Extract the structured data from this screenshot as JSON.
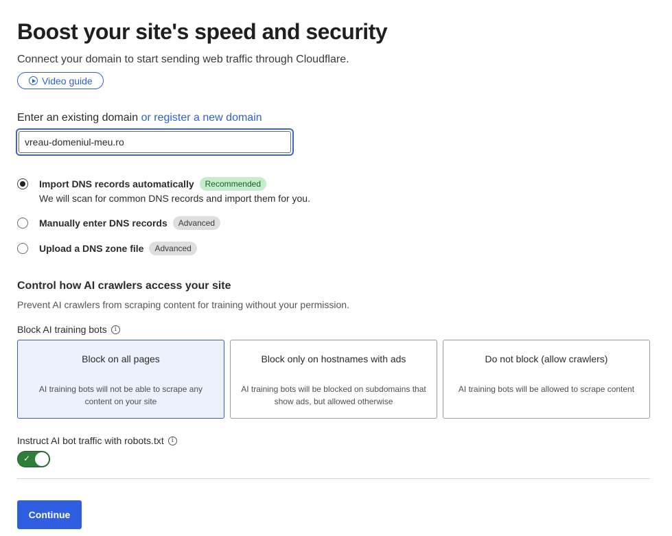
{
  "header": {
    "title": "Boost your site's speed and security",
    "subtitle": "Connect your domain to start sending web traffic through Cloudflare.",
    "video_guide_label": "Video guide"
  },
  "domain": {
    "label": "Enter an existing domain",
    "register_link": "or register a new domain",
    "value": "vreau-domeniul-meu.ro"
  },
  "dns_options": [
    {
      "label": "Import DNS records automatically",
      "badge": "Recommended",
      "selected": true,
      "description": "We will scan for common DNS records and import them for you."
    },
    {
      "label": "Manually enter DNS records",
      "badge": "Advanced",
      "selected": false
    },
    {
      "label": "Upload a DNS zone file",
      "badge": "Advanced",
      "selected": false
    }
  ],
  "ai_section": {
    "title": "Control how AI crawlers access your site",
    "description": "Prevent AI crawlers from scraping content for training without your permission.",
    "block_label": "Block AI training bots",
    "cards": [
      {
        "title": "Block on all pages",
        "description": "AI training bots will not be able to scrape any content on your site",
        "selected": true
      },
      {
        "title": "Block only on hostnames with ads",
        "description": "AI training bots will be blocked on subdomains that show ads, but allowed otherwise",
        "selected": false
      },
      {
        "title": "Do not block (allow crawlers)",
        "description": "AI training bots will be allowed to scrape content",
        "selected": false
      }
    ],
    "robots_label": "Instruct AI bot traffic with robots.txt",
    "robots_enabled": true
  },
  "footer": {
    "continue_label": "Continue"
  },
  "colors": {
    "accent": "#2f5fe0",
    "link": "#2f5ecf",
    "toggle_on": "#2e7d3a",
    "recommended_badge": "#c5eccb"
  }
}
